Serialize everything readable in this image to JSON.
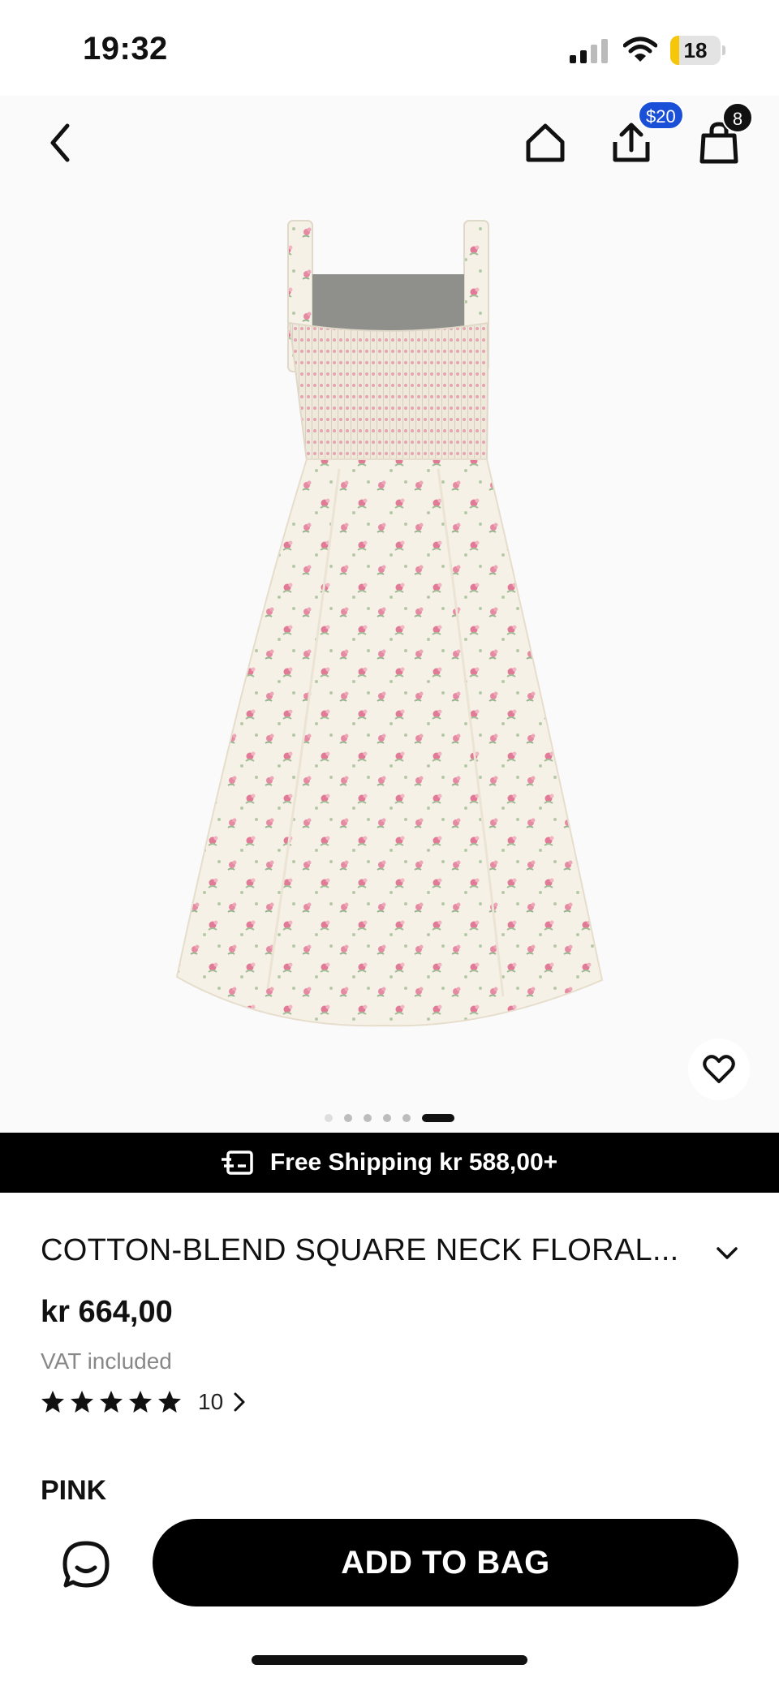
{
  "status_bar": {
    "time": "19:32",
    "battery_level": "18",
    "battery_fill_fraction": 0.18,
    "battery_color": "#f5c60a"
  },
  "header": {
    "back_icon": "chevron-left-icon",
    "home_icon": "home-icon",
    "share_icon": "share-icon",
    "share_badge": "$20",
    "bag_icon": "shopping-bag-icon",
    "bag_count": "8",
    "share_badge_color": "#1a4fd8"
  },
  "gallery": {
    "image_description_icon": "floral-dress-image",
    "total_images": 6,
    "active_index": 5,
    "wishlist_icon": "heart-icon"
  },
  "shipping_banner": {
    "icon": "shipping-icon",
    "text": "Free Shipping kr 588,00+"
  },
  "product": {
    "title": "COTTON-BLEND SQUARE NECK FLORAL...",
    "price": "kr 664,00",
    "vat_note": "VAT included",
    "rating_stars": 5,
    "review_count": "10",
    "color_label": "PINK"
  },
  "actions": {
    "chat_icon": "chat-icon",
    "add_to_bag_label": "ADD TO BAG"
  }
}
